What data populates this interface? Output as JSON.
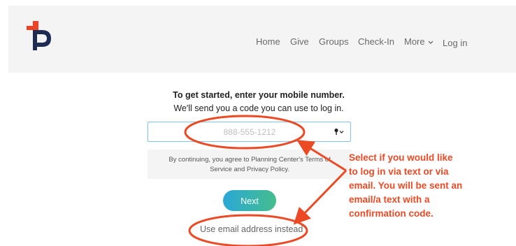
{
  "nav": {
    "items": [
      "Home",
      "Give",
      "Groups",
      "Check-In",
      "More"
    ],
    "login_label": "Log in"
  },
  "intro": {
    "title": "To get started, enter your mobile number.",
    "subtitle": "We'll send you a code you can use to log in."
  },
  "phone": {
    "placeholder": "888-555-1212",
    "value": ""
  },
  "terms": {
    "line1": "By continuing, you agree to Planning Center's Terms of",
    "line2": "Service and Privacy Policy."
  },
  "buttons": {
    "next_label": "Next",
    "email_link": "Use email address instead"
  },
  "annotation": {
    "lines": [
      "Select if you would like",
      "to log in via text or via",
      "email. You will be sent an",
      "email/a text with a",
      "confirmation code."
    ]
  },
  "colors": {
    "logo_orange": "#ef4123",
    "logo_navy": "#1e2b52",
    "annotation_red": "#ec4a24",
    "input_border": "#7fc4ee",
    "button_gradient_start": "#2aa8d6",
    "button_gradient_end": "#45bd8e"
  },
  "icons": {
    "logo": "planning-center-logo",
    "country_picker": "key-chevron-icon",
    "more_dropdown": "chevron-down-icon"
  }
}
